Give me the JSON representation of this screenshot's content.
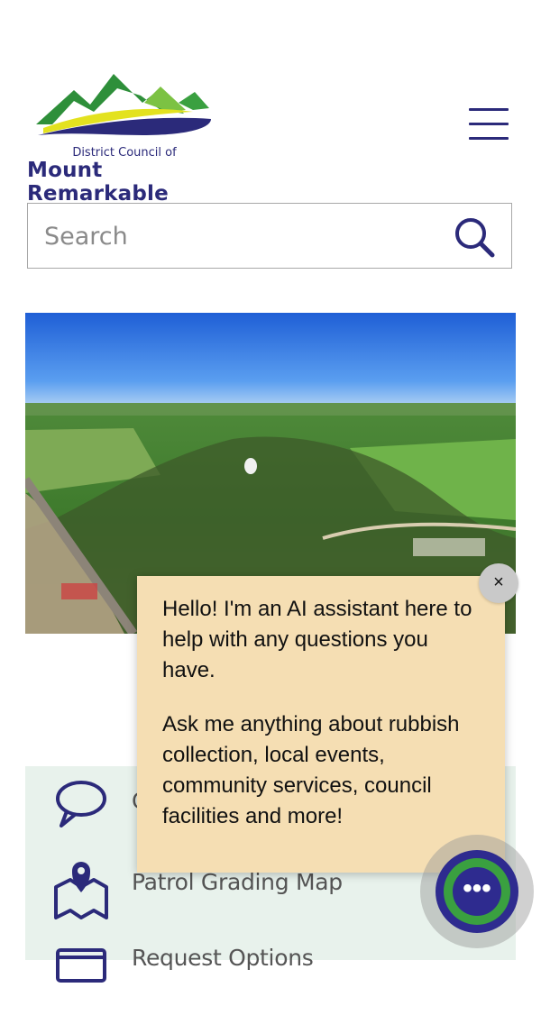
{
  "header": {
    "logo_line1": "District Council of",
    "logo_line2": "Mount Remarkable",
    "menu_icon": "hamburger-menu-icon"
  },
  "search": {
    "placeholder": "Search",
    "value": "",
    "icon": "search-icon"
  },
  "hero": {
    "image": "aerial-town-landscape"
  },
  "quick_links": {
    "items": [
      {
        "label": "C",
        "icon": "speech-bubble-icon"
      },
      {
        "label": "Patrol Grading Map",
        "icon": "map-pin-icon"
      },
      {
        "label": "Request Options",
        "icon": "form-icon"
      }
    ]
  },
  "chat": {
    "message_1": "Hello! I'm an AI assistant here to help with any questions you have.",
    "message_2": "Ask me anything about rubbish collection, local events, community services, council facilities and more!",
    "close_label": "×",
    "launcher_label": "•••",
    "colors": {
      "bubble": "#f5deb3",
      "launcher_ring": "#2e2b8f",
      "launcher_accent": "#3aa040"
    }
  },
  "colors": {
    "brand_navy": "#2b2a7a",
    "brand_green": "#3aa040",
    "brand_yellow": "#e3e21f",
    "panel_bg": "#e8f2ec"
  }
}
